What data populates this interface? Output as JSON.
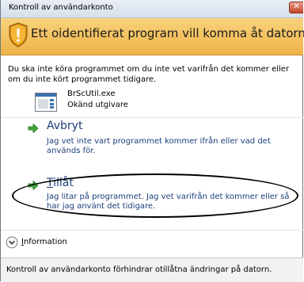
{
  "window": {
    "title": "Kontroll av användarkonto",
    "close_label": "✕"
  },
  "banner": {
    "text": "Ett oidentifierat program vill komma åt datorn",
    "color": "#efb348"
  },
  "intro_text": "Du ska inte köra programmet om du inte vet varifrån det kommer eller om du inte kört programmet tidigare.",
  "program": {
    "name": "BrScUtil.exe",
    "publisher": "Okänd utgivare",
    "icon": "application-icon"
  },
  "options": [
    {
      "title": "Avbryt",
      "description": "Jag vet inte vart programmet kommer ifrån eller vad det används för.",
      "icon": "green-arrow-icon"
    },
    {
      "title": "Tillåt",
      "description": "Jag litar på programmet. Jag vet varifrån det kommer eller så har jag använt det tidigare.",
      "icon": "green-arrow-icon"
    }
  ],
  "details": {
    "label": "Information",
    "icon": "chevron-down-icon"
  },
  "footer_text": "Kontroll av användarkonto förhindrar otillåtna ändringar på datorn."
}
